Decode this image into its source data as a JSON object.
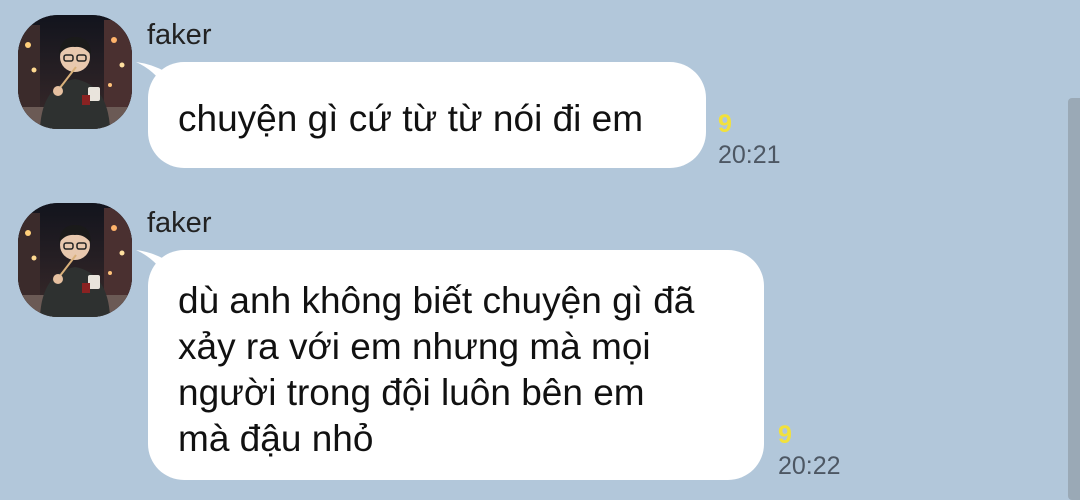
{
  "chat": {
    "messages": [
      {
        "sender": "faker",
        "text": "chuyện gì cứ từ từ nói đi em",
        "unread": "9",
        "time": "20:21"
      },
      {
        "sender": "faker",
        "lines": [
          "dù anh không biết chuyện gì đã",
          "xảy ra với em nhưng mà mọi",
          "người trong đội luôn bên em",
          "mà đậu nhỏ"
        ],
        "unread": "9",
        "time": "20:22"
      }
    ]
  },
  "colors": {
    "background": "#b2c7da",
    "bubble": "#ffffff",
    "unread": "#f2e13c",
    "time": "#4d5763"
  },
  "icons": {
    "avatar": "profile-photo-person-at-night"
  }
}
